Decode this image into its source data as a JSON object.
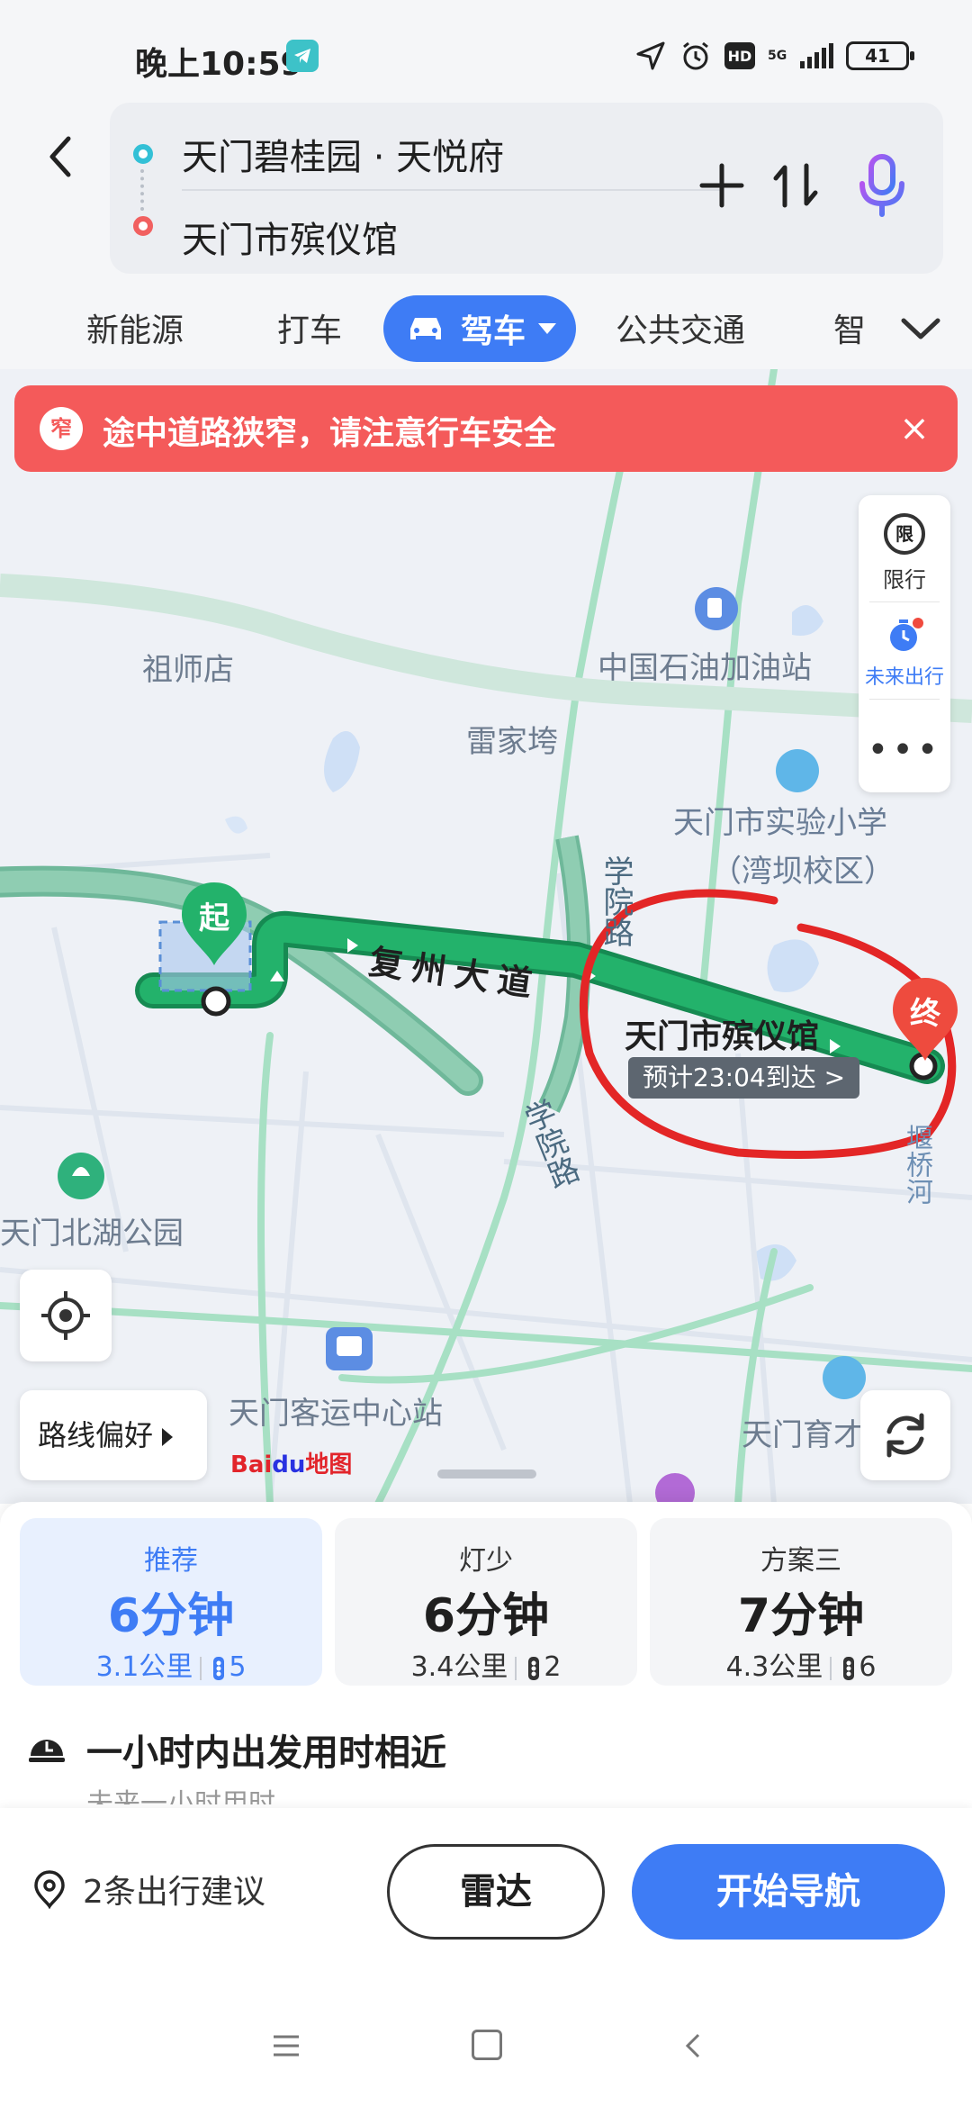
{
  "status_bar": {
    "time": "晚上10:59",
    "hd": "HD",
    "network": "5G",
    "battery": "41"
  },
  "route": {
    "from": "天门碧桂园 · 天悦府",
    "to": "天门市殡仪馆"
  },
  "modes": {
    "energy": "新能源",
    "taxi": "打车",
    "drive": "驾车",
    "transit": "公共交通",
    "smart": "智"
  },
  "banner": {
    "badge": "窄",
    "text": "途中道路狭窄，请注意行车安全",
    "close": "×"
  },
  "map": {
    "pois": {
      "zhushi": "祖师店",
      "leijia": "雷家垮",
      "oil": "中国石油加油站",
      "school_line1": "天门市实验小学",
      "school_line2": "（湾坝校区）",
      "park": "天门北湖公园",
      "bus": "天门客运中心站",
      "sport": "天门育才"
    },
    "roads": {
      "xueyuan_a": "学院路",
      "xueyuan_b": "学院路",
      "fuzhou": "复州大道",
      "river": "堰桥河"
    },
    "start_marker": "起",
    "end_marker": "终",
    "dest_label": "天门市殡仪馆",
    "eta": "预计23:04到达 >",
    "side": {
      "restrict_icon": "限",
      "restrict": "限行",
      "future": "未来出行",
      "more": "•••"
    },
    "pref": "路线偏好",
    "brand_bai": "Bai",
    "brand_du": "du",
    "brand_map": "地图"
  },
  "routes": [
    {
      "title": "推荐",
      "time": "6分钟",
      "distance": "3.1公里",
      "lights": "5"
    },
    {
      "title": "灯少",
      "time": "6分钟",
      "distance": "3.4公里",
      "lights": "2"
    },
    {
      "title": "方案三",
      "time": "7分钟",
      "distance": "4.3公里",
      "lights": "6"
    }
  ],
  "similar": {
    "title": "一小时内出发用时相近",
    "subtitle": "未来一小时用时"
  },
  "actions": {
    "suggestions": "2条出行建议",
    "radar": "雷达",
    "navigate": "开始导航"
  },
  "colors": {
    "accent": "#3e7cf5",
    "route_green": "#23b26b",
    "alert_red": "#f45a5a"
  }
}
